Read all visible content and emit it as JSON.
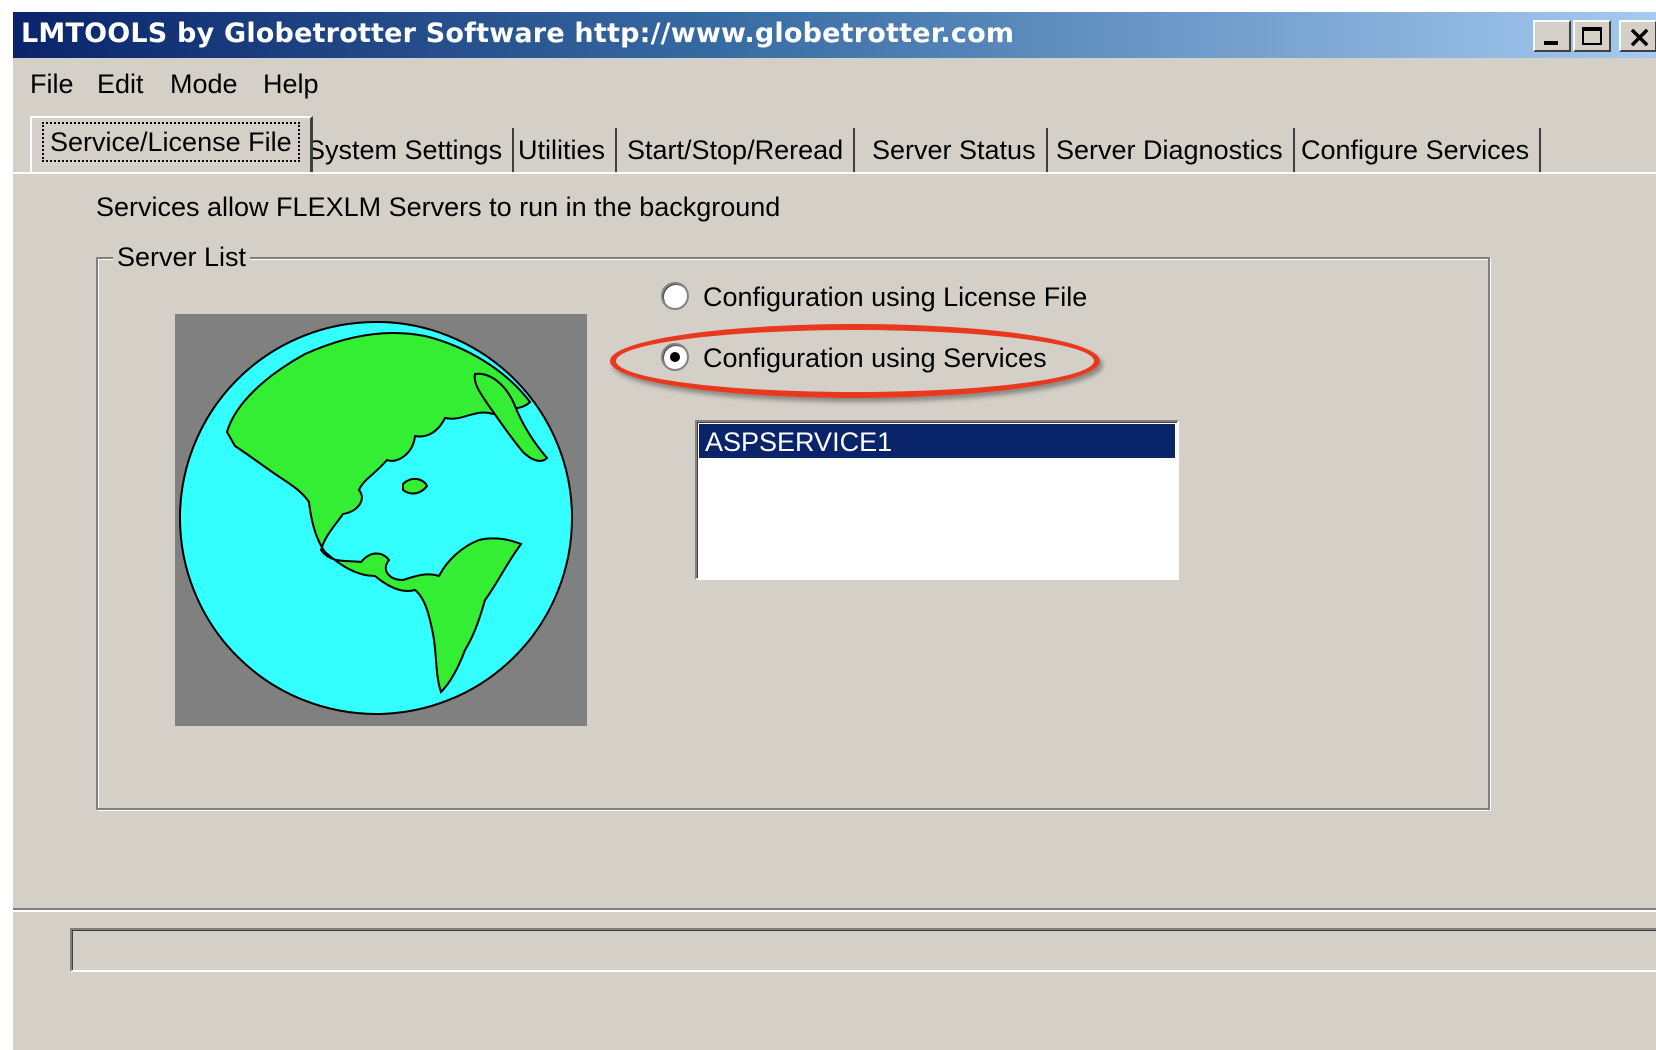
{
  "window": {
    "title": "LMTOOLS by Globetrotter Software http://www.globetrotter.com",
    "minimize_icon": "minimize-icon",
    "maximize_icon": "maximize-icon",
    "close_icon": "close-icon"
  },
  "menu": [
    "File",
    "Edit",
    "Mode",
    "Help"
  ],
  "tabs": [
    {
      "label": "Service/License File",
      "active": true
    },
    {
      "label": "System Settings",
      "active": false
    },
    {
      "label": "Utilities",
      "active": false
    },
    {
      "label": "Start/Stop/Reread",
      "active": false
    },
    {
      "label": "Server Status",
      "active": false
    },
    {
      "label": "Server Diagnostics",
      "active": false
    },
    {
      "label": "Configure Services",
      "active": false
    }
  ],
  "panel": {
    "description": "Services allow FLEXLM Servers to run in the background",
    "group_label": "Server List",
    "globe_icon": "globe-americas-icon",
    "radio_options": [
      {
        "label": "Configuration using License File",
        "selected": false
      },
      {
        "label": "Configuration using Services",
        "selected": true
      }
    ],
    "services": [
      {
        "name": "ASPSERVICE1",
        "selected": true
      }
    ],
    "highlight_color": "#e8391e"
  },
  "status": {
    "text": ""
  },
  "colors": {
    "face": "#d4d0c8",
    "title_start": "#0a246a",
    "title_end": "#a6caf0",
    "selection": "#0a246a",
    "globe_ocean": "#33ffff",
    "globe_land": "#33ee33"
  }
}
